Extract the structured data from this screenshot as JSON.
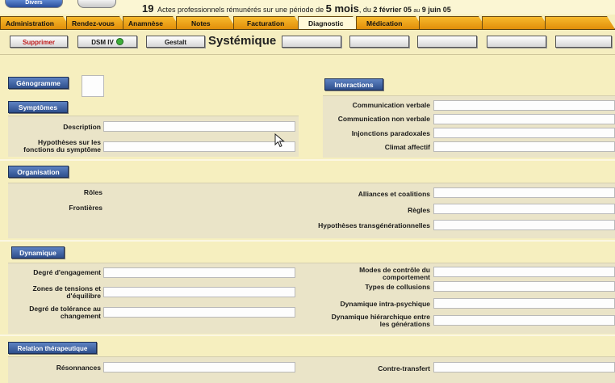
{
  "top": {
    "button_left": "Divers",
    "stat_count": "19",
    "stat_text": "Actes professionnels rémunérés sur une période de",
    "stat_period": "5 mois",
    "stat_sep": ", du",
    "stat_from": "2 février 05",
    "stat_au": "au",
    "stat_to": "9 juin 05"
  },
  "tabs": [
    "Administration",
    "Rendez-vous",
    "Anamnèse",
    "Notes",
    "Facturation",
    "Diagnostic",
    "Médication",
    "",
    "",
    ""
  ],
  "active_tab": "Diagnostic",
  "actions": {
    "delete": "Supprimer",
    "dsm": "DSM IV",
    "gestalt": "Gestalt",
    "section_title": "Systémique"
  },
  "sections": {
    "genogram": "Génogramme",
    "symptoms": "Symptômes",
    "interactions": "Interactions",
    "organisation": "Organisation",
    "dynamics": "Dynamique",
    "relation": "Relation thérapeutique"
  },
  "labels": {
    "description": "Description",
    "hypotheses": "Hypothèses sur les fonctions du symptôme",
    "comm_verbale": "Communication verbale",
    "comm_non_verbale": "Communication non verbale",
    "injonctions": "Injonctions paradoxales",
    "climat": "Climat affectif",
    "roles": "Rôles",
    "frontieres": "Frontières",
    "alliances": "Alliances et coalitions",
    "regles": "Règles",
    "hyp_trans": "Hypothèses transgénérationnelles",
    "engagement": "Degré d'engagement",
    "zones": "Zones de tensions et d'équilibre",
    "tolerance": "Degré de tolérance au changement",
    "modes": "Modes de contrôle du comportement",
    "collusions": "Types de collusions",
    "intra": "Dynamique intra-psychique",
    "hierarchique": "Dynamique hiérarchique entre les générations",
    "resonances": "Résonnances",
    "contre_transfert": "Contre-transfert"
  },
  "colors": {
    "background": "#f6efbf",
    "tab": "#f0a21a",
    "section_button": "#3e63a6",
    "delete_text": "#c01818"
  }
}
